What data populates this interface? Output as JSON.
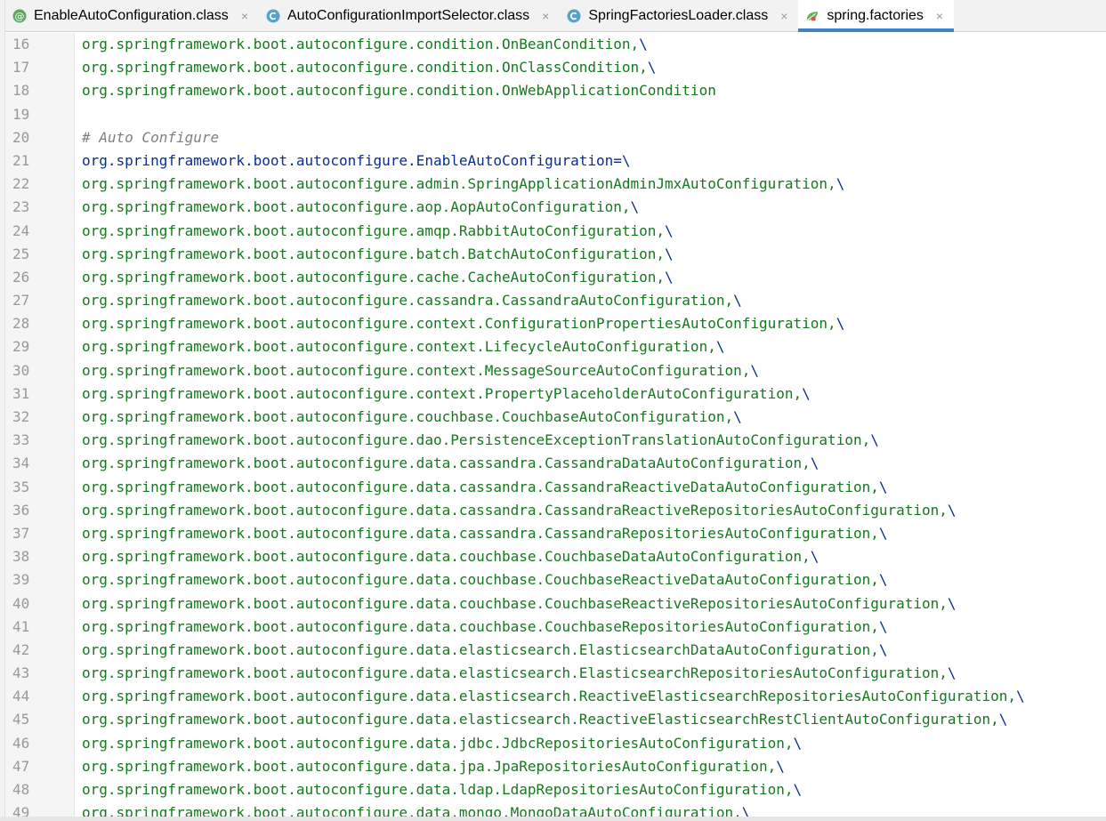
{
  "tabs": [
    {
      "label": "EnableAutoConfiguration.class",
      "icon": "annotation-icon",
      "active": false,
      "close": "×"
    },
    {
      "label": "AutoConfigurationImportSelector.class",
      "icon": "class-icon",
      "active": false,
      "close": "×"
    },
    {
      "label": "SpringFactoriesLoader.class",
      "icon": "class-icon",
      "active": false,
      "close": "×"
    },
    {
      "label": "spring.factories",
      "icon": "spring-factories-icon",
      "active": true,
      "close": "×"
    }
  ],
  "colors": {
    "accent": "#4083c9",
    "value_text": "#16781f",
    "key_text": "#0b2d91",
    "comment_text": "#808080",
    "line_number": "#999999"
  },
  "editor": {
    "lines": [
      {
        "num": "16",
        "text": "org.springframework.boot.autoconfigure.condition.OnBeanCondition,",
        "bs": "\\",
        "kind": "green"
      },
      {
        "num": "17",
        "text": "org.springframework.boot.autoconfigure.condition.OnClassCondition,",
        "bs": "\\",
        "kind": "green"
      },
      {
        "num": "18",
        "text": "org.springframework.boot.autoconfigure.condition.OnWebApplicationCondition",
        "bs": "",
        "kind": "green"
      },
      {
        "num": "19",
        "text": "",
        "bs": "",
        "kind": "green"
      },
      {
        "num": "20",
        "text": "# Auto Configure",
        "bs": "",
        "kind": "comment"
      },
      {
        "num": "21",
        "text": "org.springframework.boot.autoconfigure.EnableAutoConfiguration=",
        "bs": "\\",
        "kind": "blue"
      },
      {
        "num": "22",
        "text": "org.springframework.boot.autoconfigure.admin.SpringApplicationAdminJmxAutoConfiguration,",
        "bs": "\\",
        "kind": "green"
      },
      {
        "num": "23",
        "text": "org.springframework.boot.autoconfigure.aop.AopAutoConfiguration,",
        "bs": "\\",
        "kind": "green"
      },
      {
        "num": "24",
        "text": "org.springframework.boot.autoconfigure.amqp.RabbitAutoConfiguration,",
        "bs": "\\",
        "kind": "green"
      },
      {
        "num": "25",
        "text": "org.springframework.boot.autoconfigure.batch.BatchAutoConfiguration,",
        "bs": "\\",
        "kind": "green"
      },
      {
        "num": "26",
        "text": "org.springframework.boot.autoconfigure.cache.CacheAutoConfiguration,",
        "bs": "\\",
        "kind": "green"
      },
      {
        "num": "27",
        "text": "org.springframework.boot.autoconfigure.cassandra.CassandraAutoConfiguration,",
        "bs": "\\",
        "kind": "green"
      },
      {
        "num": "28",
        "text": "org.springframework.boot.autoconfigure.context.ConfigurationPropertiesAutoConfiguration,",
        "bs": "\\",
        "kind": "green"
      },
      {
        "num": "29",
        "text": "org.springframework.boot.autoconfigure.context.LifecycleAutoConfiguration,",
        "bs": "\\",
        "kind": "green"
      },
      {
        "num": "30",
        "text": "org.springframework.boot.autoconfigure.context.MessageSourceAutoConfiguration,",
        "bs": "\\",
        "kind": "green"
      },
      {
        "num": "31",
        "text": "org.springframework.boot.autoconfigure.context.PropertyPlaceholderAutoConfiguration,",
        "bs": "\\",
        "kind": "green"
      },
      {
        "num": "32",
        "text": "org.springframework.boot.autoconfigure.couchbase.CouchbaseAutoConfiguration,",
        "bs": "\\",
        "kind": "green"
      },
      {
        "num": "33",
        "text": "org.springframework.boot.autoconfigure.dao.PersistenceExceptionTranslationAutoConfiguration,",
        "bs": "\\",
        "kind": "green"
      },
      {
        "num": "34",
        "text": "org.springframework.boot.autoconfigure.data.cassandra.CassandraDataAutoConfiguration,",
        "bs": "\\",
        "kind": "green"
      },
      {
        "num": "35",
        "text": "org.springframework.boot.autoconfigure.data.cassandra.CassandraReactiveDataAutoConfiguration,",
        "bs": "\\",
        "kind": "green"
      },
      {
        "num": "36",
        "text": "org.springframework.boot.autoconfigure.data.cassandra.CassandraReactiveRepositoriesAutoConfiguration,",
        "bs": "\\",
        "kind": "green"
      },
      {
        "num": "37",
        "text": "org.springframework.boot.autoconfigure.data.cassandra.CassandraRepositoriesAutoConfiguration,",
        "bs": "\\",
        "kind": "green"
      },
      {
        "num": "38",
        "text": "org.springframework.boot.autoconfigure.data.couchbase.CouchbaseDataAutoConfiguration,",
        "bs": "\\",
        "kind": "green"
      },
      {
        "num": "39",
        "text": "org.springframework.boot.autoconfigure.data.couchbase.CouchbaseReactiveDataAutoConfiguration,",
        "bs": "\\",
        "kind": "green"
      },
      {
        "num": "40",
        "text": "org.springframework.boot.autoconfigure.data.couchbase.CouchbaseReactiveRepositoriesAutoConfiguration,",
        "bs": "\\",
        "kind": "green"
      },
      {
        "num": "41",
        "text": "org.springframework.boot.autoconfigure.data.couchbase.CouchbaseRepositoriesAutoConfiguration,",
        "bs": "\\",
        "kind": "green"
      },
      {
        "num": "42",
        "text": "org.springframework.boot.autoconfigure.data.elasticsearch.ElasticsearchDataAutoConfiguration,",
        "bs": "\\",
        "kind": "green"
      },
      {
        "num": "43",
        "text": "org.springframework.boot.autoconfigure.data.elasticsearch.ElasticsearchRepositoriesAutoConfiguration,",
        "bs": "\\",
        "kind": "green"
      },
      {
        "num": "44",
        "text": "org.springframework.boot.autoconfigure.data.elasticsearch.ReactiveElasticsearchRepositoriesAutoConfiguration,",
        "bs": "\\",
        "kind": "green"
      },
      {
        "num": "45",
        "text": "org.springframework.boot.autoconfigure.data.elasticsearch.ReactiveElasticsearchRestClientAutoConfiguration,",
        "bs": "\\",
        "kind": "green"
      },
      {
        "num": "46",
        "text": "org.springframework.boot.autoconfigure.data.jdbc.JdbcRepositoriesAutoConfiguration,",
        "bs": "\\",
        "kind": "green"
      },
      {
        "num": "47",
        "text": "org.springframework.boot.autoconfigure.data.jpa.JpaRepositoriesAutoConfiguration,",
        "bs": "\\",
        "kind": "green"
      },
      {
        "num": "48",
        "text": "org.springframework.boot.autoconfigure.data.ldap.LdapRepositoriesAutoConfiguration,",
        "bs": "\\",
        "kind": "green"
      },
      {
        "num": "49",
        "text": "org.springframework.boot.autoconfigure.data.mongo.MongoDataAutoConfiguration,",
        "bs": "\\",
        "kind": "green"
      }
    ]
  }
}
